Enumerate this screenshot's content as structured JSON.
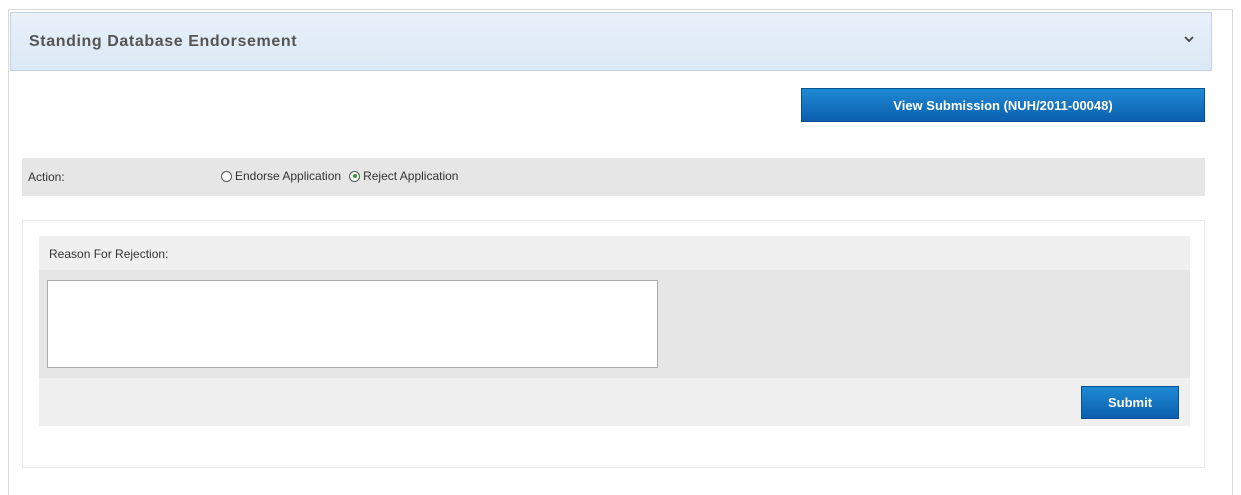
{
  "panel": {
    "title": "Standing Database Endorsement",
    "collapse_icon": "chevron-down-icon"
  },
  "toolbar": {
    "view_submission_label": "View Submission (NUH/2011-00048)"
  },
  "action": {
    "label": "Action:",
    "options": [
      {
        "label": "Endorse Application",
        "checked": false
      },
      {
        "label": "Reject Application",
        "checked": true
      }
    ],
    "checked_color": "#2c9a2c"
  },
  "rejection": {
    "label": "Reason For Rejection:",
    "value": "",
    "submit_label": "Submit"
  },
  "colors": {
    "accent_button": "#0b5fae",
    "header_bg": "#dbe8f5"
  }
}
